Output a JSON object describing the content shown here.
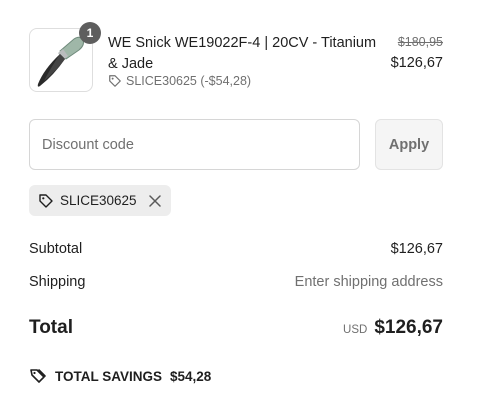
{
  "product": {
    "quantity": "1",
    "title": "WE Snick WE19022F-4 | 20CV - Titanium & Jade",
    "discount_line": "SLICE30625 (-$54,28)",
    "price_original": "$180,95",
    "price_current": "$126,67",
    "icon": "knife-product-image"
  },
  "discount": {
    "placeholder": "Discount code",
    "value": "",
    "apply_label": "Apply"
  },
  "applied_code": {
    "code": "SLICE30625",
    "icon": "tag-icon",
    "remove_icon": "close-icon"
  },
  "summary": {
    "subtotal_label": "Subtotal",
    "subtotal_value": "$126,67",
    "shipping_label": "Shipping",
    "shipping_value": "Enter shipping address",
    "total_label": "Total",
    "currency": "USD",
    "total_value": "$126,67"
  },
  "savings": {
    "label": "TOTAL SAVINGS",
    "value": "$54,28",
    "icon": "tags-icon"
  },
  "colors": {
    "text": "#1f1f1f",
    "muted": "#707070",
    "border": "#d6d6d6",
    "chip_bg": "#ededed",
    "badge_bg": "#5e5e5e"
  }
}
